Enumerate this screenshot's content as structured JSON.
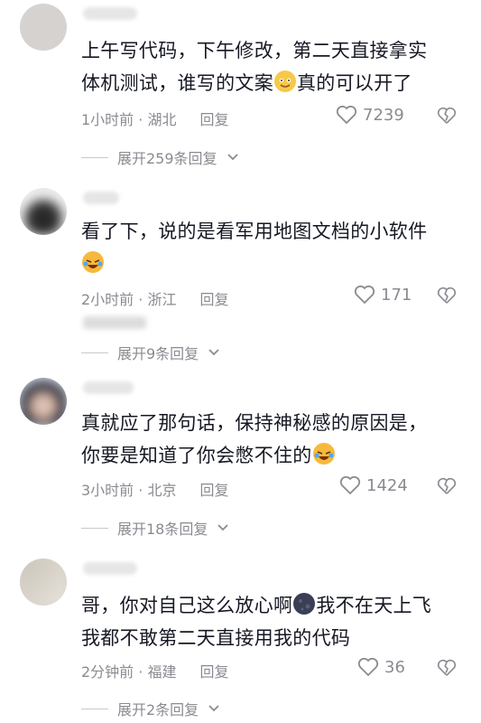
{
  "comments": [
    {
      "line1": "上午写代码，下午修改，第二天直接拿实",
      "line2a": "体机测试，谁写的文案",
      "line2b": "真的可以开了",
      "time": "1小时前 · 湖北",
      "reply": "回复",
      "likes": "7239",
      "expand": "展开259条回复"
    },
    {
      "line1": "看了下，说的是看军用地图文档的小软件",
      "time": "2小时前 · 浙江",
      "reply": "回复",
      "likes": "171",
      "expand": "展开9条回复"
    },
    {
      "line1": "真就应了那句话，保持神秘感的原因是，",
      "line2": "你要是知道了你会憋不住的",
      "time": "3小时前 · 北京",
      "reply": "回复",
      "likes": "1424",
      "expand": "展开18条回复"
    },
    {
      "line1a": "哥，你对自己这么放心啊",
      "line1b": "我不在天上飞",
      "line2": "我都不敢第二天直接用我的代码",
      "time": "2分钟前 · 福建",
      "reply": "回复",
      "likes": "36",
      "expand": "展开2条回复"
    }
  ],
  "icons": {
    "like": "heart-outline-icon",
    "dislike": "broken-heart-icon",
    "expand": "chevron-down-icon"
  },
  "colors": {
    "text": "#161823",
    "meta": "#8a8b91"
  }
}
